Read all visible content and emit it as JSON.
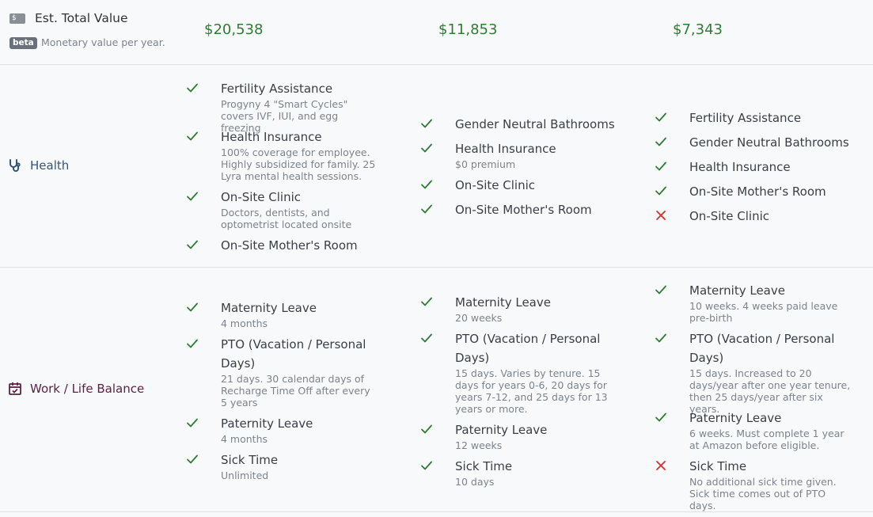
{
  "header": {
    "icon": "money-bill-icon",
    "icon_text": "$",
    "title": "Est. Total Value",
    "badge": "beta",
    "subtitle": "Monetary value per year."
  },
  "prices": [
    "$20,538",
    "$11,853",
    "$7,343"
  ],
  "colors": {
    "check": "#2e7d32",
    "cross": "#d32f2f",
    "price": "#2e7d32",
    "health": "#335577",
    "wlb": "#5a2342"
  },
  "categories": {
    "health": {
      "label": "Health",
      "icon": "stethoscope-icon",
      "columns": [
        [
          {
            "title": "Fertility Assistance",
            "desc": "Progyny 4 \"Smart Cycles\" covers IVF, IUI, and egg freezing",
            "has": true
          },
          {
            "title": "Health Insurance",
            "desc": "100% coverage for employee. Highly subsidized for family. 25 Lyra mental health sessions.",
            "has": true
          },
          {
            "title": "On-Site Clinic",
            "desc": "Doctors, dentists, and optometrist located onsite",
            "has": true
          },
          {
            "title": "On-Site Mother's Room",
            "desc": "",
            "has": true
          }
        ],
        [
          {
            "title": "Gender Neutral Bathrooms",
            "desc": "",
            "has": true
          },
          {
            "title": "Health Insurance",
            "desc": "$0 premium",
            "has": true
          },
          {
            "title": "On-Site Clinic",
            "desc": "",
            "has": true
          },
          {
            "title": "On-Site Mother's Room",
            "desc": "",
            "has": true
          }
        ],
        [
          {
            "title": "Fertility Assistance",
            "desc": "",
            "has": true
          },
          {
            "title": "Gender Neutral Bathrooms",
            "desc": "",
            "has": true
          },
          {
            "title": "Health Insurance",
            "desc": "",
            "has": true
          },
          {
            "title": "On-Site Mother's Room",
            "desc": "",
            "has": true
          },
          {
            "title": "On-Site Clinic",
            "desc": "",
            "has": false
          }
        ]
      ]
    },
    "wlb": {
      "label": "Work / Life Balance",
      "icon": "calendar-check-icon",
      "columns": [
        [
          {
            "title": "Maternity Leave",
            "desc": "4 months",
            "has": true
          },
          {
            "title": "PTO (Vacation / Personal Days)",
            "desc": "21 days. 30 calendar days of Recharge Time Off after every 5 years",
            "has": true
          },
          {
            "title": "Paternity Leave",
            "desc": "4 months",
            "has": true
          },
          {
            "title": "Sick Time",
            "desc": "Unlimited",
            "has": true
          }
        ],
        [
          {
            "title": "Maternity Leave",
            "desc": "20 weeks",
            "has": true
          },
          {
            "title": "PTO (Vacation / Personal Days)",
            "desc": "15 days. Varies by tenure. 15 days for years 0-6, 20 days for years 7-12, and 25 days for 13 years or more.",
            "has": true
          },
          {
            "title": "Paternity Leave",
            "desc": "12 weeks",
            "has": true
          },
          {
            "title": "Sick Time",
            "desc": "10 days",
            "has": true
          }
        ],
        [
          {
            "title": "Maternity Leave",
            "desc": "10 weeks. 4 weeks paid leave pre-birth",
            "has": true
          },
          {
            "title": "PTO (Vacation / Personal Days)",
            "desc": "15 days. Increased to 20 days/year after one year tenure, then 25 days/year after six years.",
            "has": true
          },
          {
            "title": "Paternity Leave",
            "desc": "6 weeks. Must complete 1 year at Amazon before eligible.",
            "has": true
          },
          {
            "title": "Sick Time",
            "desc": "No additional sick time given. Sick time comes out of PTO days.",
            "has": false
          }
        ]
      ]
    }
  }
}
